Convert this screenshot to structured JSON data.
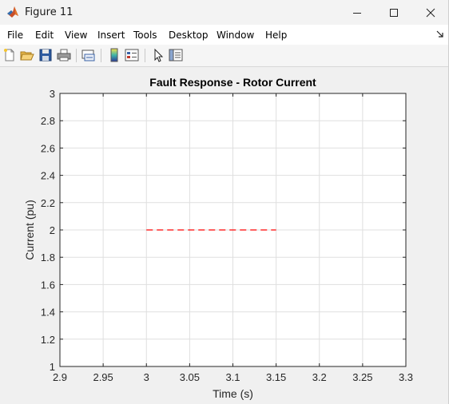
{
  "window": {
    "title": "Figure 11"
  },
  "menu": {
    "items": [
      "File",
      "Edit",
      "View",
      "Insert",
      "Tools",
      "Desktop",
      "Window",
      "Help"
    ]
  },
  "toolbar": {
    "buttons": [
      {
        "name": "new-figure-icon"
      },
      {
        "name": "open-file-icon"
      },
      {
        "name": "save-icon"
      },
      {
        "name": "print-icon"
      },
      {
        "name": "link-plot-icon"
      },
      {
        "name": "colorbar-icon"
      },
      {
        "name": "legend-icon"
      },
      {
        "name": "edit-plot-pointer-icon"
      },
      {
        "name": "property-inspector-icon"
      }
    ]
  },
  "chart_data": {
    "type": "line",
    "title": "Fault Response - Rotor Current",
    "xlabel": "Time (s)",
    "ylabel": "Current (pu)",
    "xlim": [
      2.9,
      3.3
    ],
    "ylim": [
      1,
      3
    ],
    "xticks": [
      "2.9",
      "2.95",
      "3",
      "3.05",
      "3.1",
      "3.15",
      "3.2",
      "3.25",
      "3.3"
    ],
    "yticks": [
      "1",
      "1.2",
      "1.4",
      "1.6",
      "1.8",
      "2",
      "2.2",
      "2.4",
      "2.6",
      "2.8",
      "3"
    ],
    "grid": true,
    "series": [
      {
        "color": "#ff0000",
        "line_style": "dashed",
        "x": [
          3.0,
          3.15
        ],
        "y": [
          2.0,
          2.0
        ]
      }
    ]
  }
}
